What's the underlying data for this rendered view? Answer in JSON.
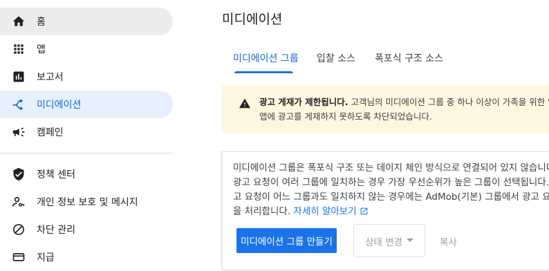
{
  "sidebar": {
    "items": [
      {
        "label": "홈",
        "icon": "home-icon"
      },
      {
        "label": "앱",
        "icon": "apps-grid-icon"
      },
      {
        "label": "보고서",
        "icon": "bar-chart-icon"
      },
      {
        "label": "미디에이션",
        "icon": "mediation-icon"
      },
      {
        "label": "캠페인",
        "icon": "megaphone-icon"
      },
      {
        "label": "정책 센터",
        "icon": "shield-check-icon"
      },
      {
        "label": "개인 정보 보호 및 메시지",
        "icon": "person-key-icon"
      },
      {
        "label": "차단 관리",
        "icon": "block-icon"
      },
      {
        "label": "지급",
        "icon": "payments-icon"
      }
    ]
  },
  "main": {
    "title": "미디에이션",
    "tabs": [
      "미디에이션 그룹",
      "입찰 소스",
      "폭포식 구조 소스"
    ],
    "warning": {
      "title": "광고 게재가 제한됩니다.",
      "line1": "고객님의 미디에이션 그룹 중 하나 이상이 가족을 위한 앱",
      "line2": "앱에 광고를 게재하지 못하도록 차단되었습니다.",
      "icon": "warning-icon"
    },
    "card": {
      "desc1": "미디에이션 그룹은 폭포식 구조 또는 데이지 체인 방식으로 연결되어 있지 않습니다.",
      "desc2": "광고 요청이 여러 그룹에 일치하는 경우 가장 우선순위가 높은 그룹이 선택됩니다. 광",
      "desc3": "고 요청이 어느 그룹과도 일치하지 않는 경우에는 AdMob(기본) 그룹에서 광고 요청",
      "desc4": "을 처리합니다.",
      "learn_more": "자세히 알아보기",
      "create_button": "미디에이션 그룹 만들기",
      "status_button": "상태 변경",
      "copy_button": "복사"
    }
  },
  "colors": {
    "accent": "#1a73e8",
    "active_bg": "#e6f0fc",
    "warning_bg": "#fef7e0"
  }
}
